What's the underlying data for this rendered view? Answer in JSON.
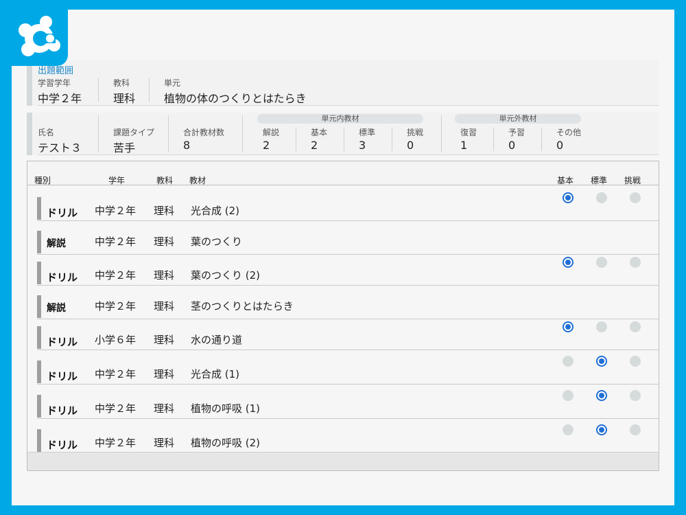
{
  "range": {
    "title": "出題範囲",
    "grade_label": "学習学年",
    "grade_value": "中学２年",
    "subject_label": "教科",
    "subject_value": "理科",
    "unit_label": "単元",
    "unit_value": "植物の体のつくりとはたらき"
  },
  "student": {
    "name_label": "氏名",
    "name_value": "テスト３",
    "type_label": "課題タイプ",
    "type_value": "苦手",
    "total_label": "合計教材数",
    "total_value": "8",
    "in_unit_title": "単元内教材",
    "in_unit": [
      {
        "label": "解説",
        "value": "2"
      },
      {
        "label": "基本",
        "value": "2"
      },
      {
        "label": "標準",
        "value": "3"
      },
      {
        "label": "挑戦",
        "value": "0"
      }
    ],
    "out_unit_title": "単元外教材",
    "out_unit": [
      {
        "label": "復習",
        "value": "1"
      },
      {
        "label": "予習",
        "value": "0"
      },
      {
        "label": "その他",
        "value": "0"
      }
    ]
  },
  "table": {
    "headers": {
      "kind": "種別",
      "grade": "学年",
      "subject": "教科",
      "material": "教材",
      "basic": "基本",
      "standard": "標準",
      "challenge": "挑戦"
    },
    "rows": [
      {
        "kind": "ドリル",
        "grade": "中学２年",
        "subject": "理科",
        "material": "光合成 (2)",
        "level": "basic"
      },
      {
        "kind": "解説",
        "grade": "中学２年",
        "subject": "理科",
        "material": "葉のつくり",
        "level": ""
      },
      {
        "kind": "ドリル",
        "grade": "中学２年",
        "subject": "理科",
        "material": "葉のつくり (2)",
        "level": "basic"
      },
      {
        "kind": "解説",
        "grade": "中学２年",
        "subject": "理科",
        "material": "茎のつくりとはたらき",
        "level": ""
      },
      {
        "kind": "ドリル",
        "grade": "小学６年",
        "subject": "理科",
        "material": "水の通り道",
        "level": "basic"
      },
      {
        "kind": "ドリル",
        "grade": "中学２年",
        "subject": "理科",
        "material": "光合成 (1)",
        "level": "standard"
      },
      {
        "kind": "ドリル",
        "grade": "中学２年",
        "subject": "理科",
        "material": "植物の呼吸 (1)",
        "level": "standard"
      },
      {
        "kind": "ドリル",
        "grade": "中学２年",
        "subject": "理科",
        "material": "植物の呼吸 (2)",
        "level": "standard"
      }
    ]
  },
  "colors": {
    "frame": "#00a9e6",
    "accent": "#1f6fd6",
    "title": "#1e88c8"
  },
  "icons": {
    "logo": "app-logo-icon",
    "radio": "radio-icon"
  }
}
